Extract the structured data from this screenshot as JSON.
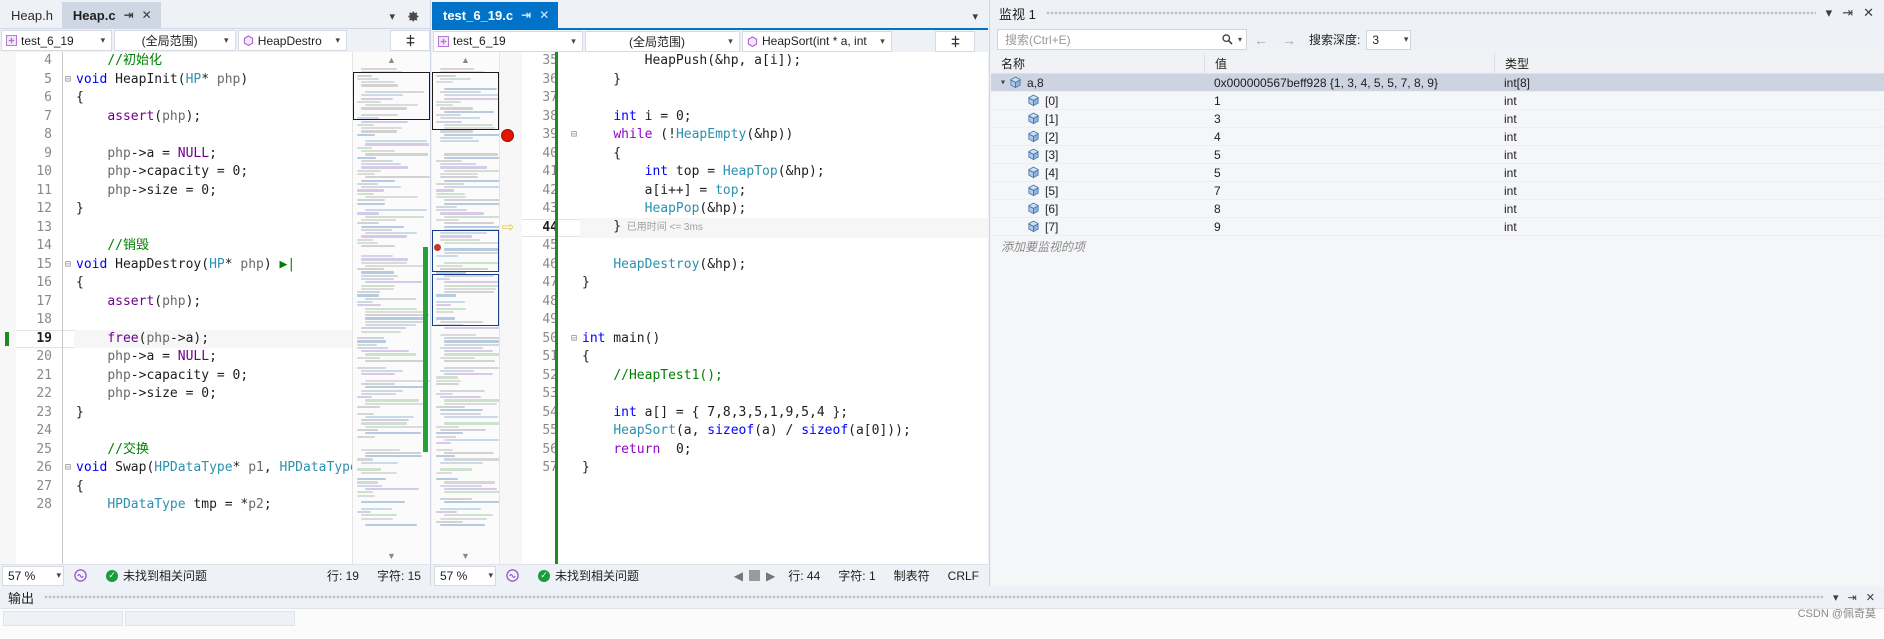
{
  "left_editor": {
    "tabs": [
      {
        "label": "Heap.h",
        "state": "inactive"
      },
      {
        "label": "Heap.c",
        "state": "selected-unfocused"
      }
    ],
    "tab_pin_glyph": "⇥",
    "tab_close_glyph": "✕",
    "navbar": {
      "project": "test_6_19",
      "scope": "(全局范围)",
      "symbol": "HeapDestro"
    },
    "status": {
      "zoom": "57 %",
      "issues": "未找到相关问题",
      "line_label": "行: 19",
      "col_label": "字符: 15"
    },
    "lines": [
      {
        "n": "4",
        "fold": "",
        "tokens": [
          {
            "t": "    ",
            "c": "plain"
          },
          {
            "t": "//初始化",
            "c": "cm"
          }
        ]
      },
      {
        "n": "5",
        "fold": "⊟",
        "tokens": [
          {
            "t": "void",
            "c": "kw"
          },
          {
            "t": " HeapInit(",
            "c": "plain"
          },
          {
            "t": "HP",
            "c": "ty"
          },
          {
            "t": "* ",
            "c": "plain"
          },
          {
            "t": "php",
            "c": "var"
          },
          {
            "t": ")",
            "c": "plain"
          }
        ]
      },
      {
        "n": "6",
        "fold": "",
        "tokens": [
          {
            "t": "{",
            "c": "plain"
          }
        ]
      },
      {
        "n": "7",
        "fold": "",
        "tokens": [
          {
            "t": "    ",
            "c": "plain"
          },
          {
            "t": "assert",
            "c": "mac"
          },
          {
            "t": "(",
            "c": "plain"
          },
          {
            "t": "php",
            "c": "var"
          },
          {
            "t": ");",
            "c": "plain"
          }
        ]
      },
      {
        "n": "8",
        "fold": "",
        "tokens": []
      },
      {
        "n": "9",
        "fold": "",
        "tokens": [
          {
            "t": "    ",
            "c": "plain"
          },
          {
            "t": "php",
            "c": "var"
          },
          {
            "t": "->a = ",
            "c": "plain"
          },
          {
            "t": "NULL",
            "c": "mac"
          },
          {
            "t": ";",
            "c": "plain"
          }
        ]
      },
      {
        "n": "10",
        "fold": "",
        "tokens": [
          {
            "t": "    ",
            "c": "plain"
          },
          {
            "t": "php",
            "c": "var"
          },
          {
            "t": "->capacity = ",
            "c": "plain"
          },
          {
            "t": "0",
            "c": "num"
          },
          {
            "t": ";",
            "c": "plain"
          }
        ]
      },
      {
        "n": "11",
        "fold": "",
        "tokens": [
          {
            "t": "    ",
            "c": "plain"
          },
          {
            "t": "php",
            "c": "var"
          },
          {
            "t": "->size = ",
            "c": "plain"
          },
          {
            "t": "0",
            "c": "num"
          },
          {
            "t": ";",
            "c": "plain"
          }
        ]
      },
      {
        "n": "12",
        "fold": "",
        "tokens": [
          {
            "t": "}",
            "c": "plain"
          }
        ]
      },
      {
        "n": "13",
        "fold": "",
        "tokens": []
      },
      {
        "n": "14",
        "fold": "",
        "tokens": [
          {
            "t": "    ",
            "c": "plain"
          },
          {
            "t": "//销毁",
            "c": "cm"
          }
        ]
      },
      {
        "n": "15",
        "fold": "⊟",
        "tokens": [
          {
            "t": "void",
            "c": "kw"
          },
          {
            "t": " HeapDestroy(",
            "c": "plain"
          },
          {
            "t": "HP",
            "c": "ty"
          },
          {
            "t": "* ",
            "c": "plain"
          },
          {
            "t": "php",
            "c": "var"
          },
          {
            "t": ") ",
            "c": "plain"
          },
          {
            "t": "▶|",
            "c": "cm"
          }
        ]
      },
      {
        "n": "16",
        "fold": "",
        "tokens": [
          {
            "t": "{",
            "c": "plain"
          }
        ]
      },
      {
        "n": "17",
        "fold": "",
        "tokens": [
          {
            "t": "    ",
            "c": "plain"
          },
          {
            "t": "assert",
            "c": "mac"
          },
          {
            "t": "(",
            "c": "plain"
          },
          {
            "t": "php",
            "c": "var"
          },
          {
            "t": ");",
            "c": "plain"
          }
        ]
      },
      {
        "n": "18",
        "fold": "",
        "tokens": []
      },
      {
        "n": "19",
        "fold": "",
        "current": true,
        "tokens": [
          {
            "t": "    ",
            "c": "plain"
          },
          {
            "t": "free",
            "c": "mac"
          },
          {
            "t": "(",
            "c": "plain"
          },
          {
            "t": "php",
            "c": "var"
          },
          {
            "t": "->a);",
            "c": "plain"
          }
        ]
      },
      {
        "n": "20",
        "fold": "",
        "tokens": [
          {
            "t": "    ",
            "c": "plain"
          },
          {
            "t": "php",
            "c": "var"
          },
          {
            "t": "->a = ",
            "c": "plain"
          },
          {
            "t": "NULL",
            "c": "mac"
          },
          {
            "t": ";",
            "c": "plain"
          }
        ]
      },
      {
        "n": "21",
        "fold": "",
        "tokens": [
          {
            "t": "    ",
            "c": "plain"
          },
          {
            "t": "php",
            "c": "var"
          },
          {
            "t": "->capacity = ",
            "c": "plain"
          },
          {
            "t": "0",
            "c": "num"
          },
          {
            "t": ";",
            "c": "plain"
          }
        ]
      },
      {
        "n": "22",
        "fold": "",
        "tokens": [
          {
            "t": "    ",
            "c": "plain"
          },
          {
            "t": "php",
            "c": "var"
          },
          {
            "t": "->size = ",
            "c": "plain"
          },
          {
            "t": "0",
            "c": "num"
          },
          {
            "t": ";",
            "c": "plain"
          }
        ]
      },
      {
        "n": "23",
        "fold": "",
        "tokens": [
          {
            "t": "}",
            "c": "plain"
          }
        ]
      },
      {
        "n": "24",
        "fold": "",
        "tokens": []
      },
      {
        "n": "25",
        "fold": "",
        "tokens": [
          {
            "t": "    ",
            "c": "plain"
          },
          {
            "t": "//交换",
            "c": "cm"
          }
        ]
      },
      {
        "n": "26",
        "fold": "⊟",
        "tokens": [
          {
            "t": "void",
            "c": "kw"
          },
          {
            "t": " Swap(",
            "c": "plain"
          },
          {
            "t": "HPDataType",
            "c": "ty"
          },
          {
            "t": "* ",
            "c": "plain"
          },
          {
            "t": "p1",
            "c": "var"
          },
          {
            "t": ", ",
            "c": "plain"
          },
          {
            "t": "HPDataType",
            "c": "ty"
          }
        ]
      },
      {
        "n": "27",
        "fold": "",
        "tokens": [
          {
            "t": "{",
            "c": "plain"
          }
        ]
      },
      {
        "n": "28",
        "fold": "",
        "tokens": [
          {
            "t": "    ",
            "c": "plain"
          },
          {
            "t": "HPDataType",
            "c": "ty"
          },
          {
            "t": " tmp = *",
            "c": "plain"
          },
          {
            "t": "p2",
            "c": "var"
          },
          {
            "t": ";",
            "c": "plain"
          }
        ]
      }
    ]
  },
  "right_editor": {
    "tabs": [
      {
        "label": "test_6_19.c",
        "state": "active"
      }
    ],
    "tab_pin_glyph": "⇥",
    "tab_close_glyph": "✕",
    "navbar": {
      "project": "test_6_19",
      "scope": "(全局范围)",
      "symbol": "HeapSort(int * a, int"
    },
    "status": {
      "zoom": "57 %",
      "issues": "未找到相关问题",
      "line_label": "行: 44",
      "col_label": "字符: 1",
      "tabmode": "制表符",
      "eol": "CRLF"
    },
    "lines": [
      {
        "n": "35",
        "fold": "",
        "clipped": true,
        "tokens": [
          {
            "t": "        HeapPush(&hp, a[i]);",
            "c": "plain"
          }
        ]
      },
      {
        "n": "36",
        "fold": "",
        "tokens": [
          {
            "t": "    }",
            "c": "plain"
          }
        ]
      },
      {
        "n": "37",
        "fold": "",
        "tokens": []
      },
      {
        "n": "38",
        "fold": "",
        "tokens": [
          {
            "t": "    ",
            "c": "plain"
          },
          {
            "t": "int",
            "c": "kw"
          },
          {
            "t": " i = ",
            "c": "plain"
          },
          {
            "t": "0",
            "c": "num"
          },
          {
            "t": ";",
            "c": "plain"
          }
        ]
      },
      {
        "n": "39",
        "fold": "⊟",
        "breakpoint": true,
        "tokens": [
          {
            "t": "    ",
            "c": "plain"
          },
          {
            "t": "while",
            "c": "kw2"
          },
          {
            "t": " (!",
            "c": "plain"
          },
          {
            "t": "HeapEmpty",
            "c": "ty"
          },
          {
            "t": "(&hp))",
            "c": "plain"
          }
        ]
      },
      {
        "n": "40",
        "fold": "",
        "tokens": [
          {
            "t": "    {",
            "c": "plain"
          }
        ]
      },
      {
        "n": "41",
        "fold": "",
        "tokens": [
          {
            "t": "        ",
            "c": "plain"
          },
          {
            "t": "int",
            "c": "kw"
          },
          {
            "t": " top = ",
            "c": "plain"
          },
          {
            "t": "HeapTop",
            "c": "ty"
          },
          {
            "t": "(&hp);",
            "c": "plain"
          }
        ]
      },
      {
        "n": "42",
        "fold": "",
        "tokens": [
          {
            "t": "        a[i++] = ",
            "c": "plain"
          },
          {
            "t": "top",
            "c": "ty"
          },
          {
            "t": ";",
            "c": "plain"
          }
        ]
      },
      {
        "n": "43",
        "fold": "",
        "tokens": [
          {
            "t": "        ",
            "c": "plain"
          },
          {
            "t": "HeapPop",
            "c": "ty"
          },
          {
            "t": "(&hp);",
            "c": "plain"
          }
        ]
      },
      {
        "n": "44",
        "fold": "",
        "current": true,
        "execution": true,
        "hint": "已用时间 <= 3ms",
        "tokens": [
          {
            "t": "    }",
            "c": "plain"
          }
        ]
      },
      {
        "n": "45",
        "fold": "",
        "tokens": []
      },
      {
        "n": "46",
        "fold": "",
        "tokens": [
          {
            "t": "    ",
            "c": "plain"
          },
          {
            "t": "HeapDestroy",
            "c": "ty"
          },
          {
            "t": "(&hp);",
            "c": "plain"
          }
        ]
      },
      {
        "n": "47",
        "fold": "",
        "tokens": [
          {
            "t": "}",
            "c": "plain"
          }
        ]
      },
      {
        "n": "48",
        "fold": "",
        "tokens": []
      },
      {
        "n": "49",
        "fold": "",
        "tokens": []
      },
      {
        "n": "50",
        "fold": "⊟",
        "tokens": [
          {
            "t": "int",
            "c": "kw"
          },
          {
            "t": " main()",
            "c": "plain"
          }
        ]
      },
      {
        "n": "51",
        "fold": "",
        "tokens": [
          {
            "t": "{",
            "c": "plain"
          }
        ]
      },
      {
        "n": "52",
        "fold": "",
        "tokens": [
          {
            "t": "    ",
            "c": "plain"
          },
          {
            "t": "//HeapTest1();",
            "c": "cm"
          }
        ]
      },
      {
        "n": "53",
        "fold": "",
        "tokens": []
      },
      {
        "n": "54",
        "fold": "",
        "tokens": [
          {
            "t": "    ",
            "c": "plain"
          },
          {
            "t": "int",
            "c": "kw"
          },
          {
            "t": " a[] = { ",
            "c": "plain"
          },
          {
            "t": "7,8,3,5,1,9,5,4",
            "c": "num"
          },
          {
            "t": " };",
            "c": "plain"
          }
        ]
      },
      {
        "n": "55",
        "fold": "",
        "tokens": [
          {
            "t": "    ",
            "c": "plain"
          },
          {
            "t": "HeapSort",
            "c": "ty"
          },
          {
            "t": "(a, ",
            "c": "plain"
          },
          {
            "t": "sizeof",
            "c": "kw"
          },
          {
            "t": "(a) / ",
            "c": "plain"
          },
          {
            "t": "sizeof",
            "c": "kw"
          },
          {
            "t": "(a[",
            "c": "plain"
          },
          {
            "t": "0",
            "c": "num"
          },
          {
            "t": "]));",
            "c": "plain"
          }
        ]
      },
      {
        "n": "56",
        "fold": "",
        "tokens": [
          {
            "t": "    ",
            "c": "plain"
          },
          {
            "t": "return",
            "c": "kw2"
          },
          {
            "t": "  ",
            "c": "plain"
          },
          {
            "t": "0",
            "c": "num"
          },
          {
            "t": ";",
            "c": "plain"
          }
        ]
      },
      {
        "n": "57",
        "fold": "",
        "tokens": [
          {
            "t": "}",
            "c": "plain"
          }
        ]
      }
    ]
  },
  "watch": {
    "title": "监视 1",
    "auto_hide_glyph": "▾",
    "pin_glyph": "⇥",
    "close_glyph": "✕",
    "search_placeholder": "搜索(Ctrl+E)",
    "search_icon": "search-icon",
    "back_glyph": "←",
    "forward_glyph": "→",
    "depth_label": "搜索深度:",
    "depth_value": "3",
    "columns": {
      "name": "名称",
      "value": "值",
      "type": "类型"
    },
    "add_watch_placeholder": "添加要监视的项",
    "rows": [
      {
        "name": "a,8",
        "value": "0x000000567beff928 {1, 3, 4, 5, 5, 7, 8, 9}",
        "type": "int[8]",
        "expanded": true,
        "selected": true,
        "depth": 0
      },
      {
        "name": "[0]",
        "value": "1",
        "type": "int",
        "depth": 1
      },
      {
        "name": "[1]",
        "value": "3",
        "type": "int",
        "depth": 1
      },
      {
        "name": "[2]",
        "value": "4",
        "type": "int",
        "depth": 1
      },
      {
        "name": "[3]",
        "value": "5",
        "type": "int",
        "depth": 1
      },
      {
        "name": "[4]",
        "value": "5",
        "type": "int",
        "depth": 1
      },
      {
        "name": "[5]",
        "value": "7",
        "type": "int",
        "depth": 1
      },
      {
        "name": "[6]",
        "value": "8",
        "type": "int",
        "depth": 1
      },
      {
        "name": "[7]",
        "value": "9",
        "type": "int",
        "depth": 1
      }
    ]
  },
  "output": {
    "title": "输出",
    "watermark": "CSDN @佩奇莫"
  },
  "colors": {
    "active_tab": "#0073c8",
    "keyword_blue": "#0000ff",
    "keyword_purple": "#8f08c4",
    "type_teal": "#2b91af",
    "comment_green": "#008000",
    "macro_purple": "#6f008a",
    "breakpoint_red": "#e51400",
    "execution_yellow": "#e9c547",
    "change_green": "#1f8b1f",
    "selection_blue": "#cdd3e0",
    "chrome_bg": "#eef1f5"
  }
}
